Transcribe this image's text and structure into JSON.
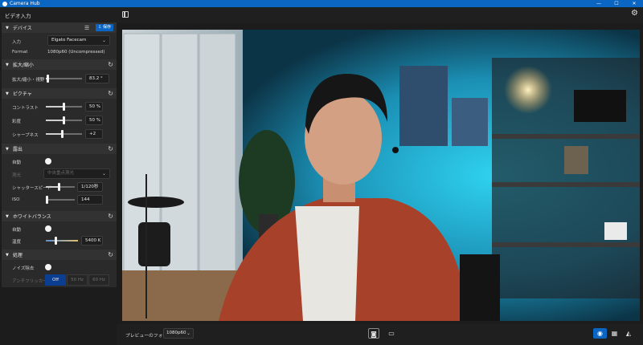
{
  "window": {
    "title": "Camera Hub",
    "controls": [
      "—",
      "☐",
      "✕"
    ]
  },
  "header": {
    "section_title": "ビデオ入力"
  },
  "device": {
    "heading": "デバイス",
    "action_label": "⇩ 保存",
    "input_label": "入力",
    "input_value": "Elgato Facecam",
    "format_label": "Format",
    "format_value": "1080p60 (Uncompressed)"
  },
  "zoom": {
    "heading": "拡大/縮小",
    "fov_label": "拡大/縮小・視野",
    "fov_value": "83.2 °",
    "fov_level": 0.05
  },
  "picture": {
    "heading": "ピクチャ",
    "contrast_label": "コントラスト",
    "contrast_value": "50 %",
    "contrast_level": 0.5,
    "saturation_label": "彩度",
    "saturation_value": "50 %",
    "saturation_level": 0.5,
    "sharpness_label": "シャープネス",
    "sharpness_value": "+2",
    "sharpness_level": 0.45
  },
  "exposure": {
    "heading": "露出",
    "auto_label": "自動",
    "metering_label": "測光",
    "metering_value": "中央重点測光",
    "shutter_label": "シャッタースピード",
    "shutter_value": "1/120秒",
    "shutter_level": 0.45,
    "iso_label": "ISO",
    "iso_value": "144",
    "iso_level": 0.05
  },
  "white_balance": {
    "heading": "ホワイトバランス",
    "auto_label": "自動",
    "temp_label": "温度",
    "temp_value": "5400 K",
    "temp_level": 0.3
  },
  "processing": {
    "heading": "処理",
    "noise_label": "ノイズ除去",
    "antiflicker_label": "アンチフリッカー",
    "options": [
      "Off",
      "50 Hz",
      "60 Hz"
    ],
    "selected": "Off"
  },
  "bottom": {
    "format_label": "プレビューのフォーマット",
    "format_value": "1080p60"
  },
  "icons": {
    "gear": "gear-icon",
    "sidebar_toggle": "sidebar-toggle-icon",
    "camera": "camera-icon",
    "folder": "folder-icon",
    "eye": "eye-icon",
    "grid": "grid-icon",
    "compare": "compare-icon",
    "reset": "reset-icon",
    "list": "list-icon"
  },
  "colors": {
    "accent": "#0a66c2",
    "selected_segment": "#0b3d91"
  }
}
